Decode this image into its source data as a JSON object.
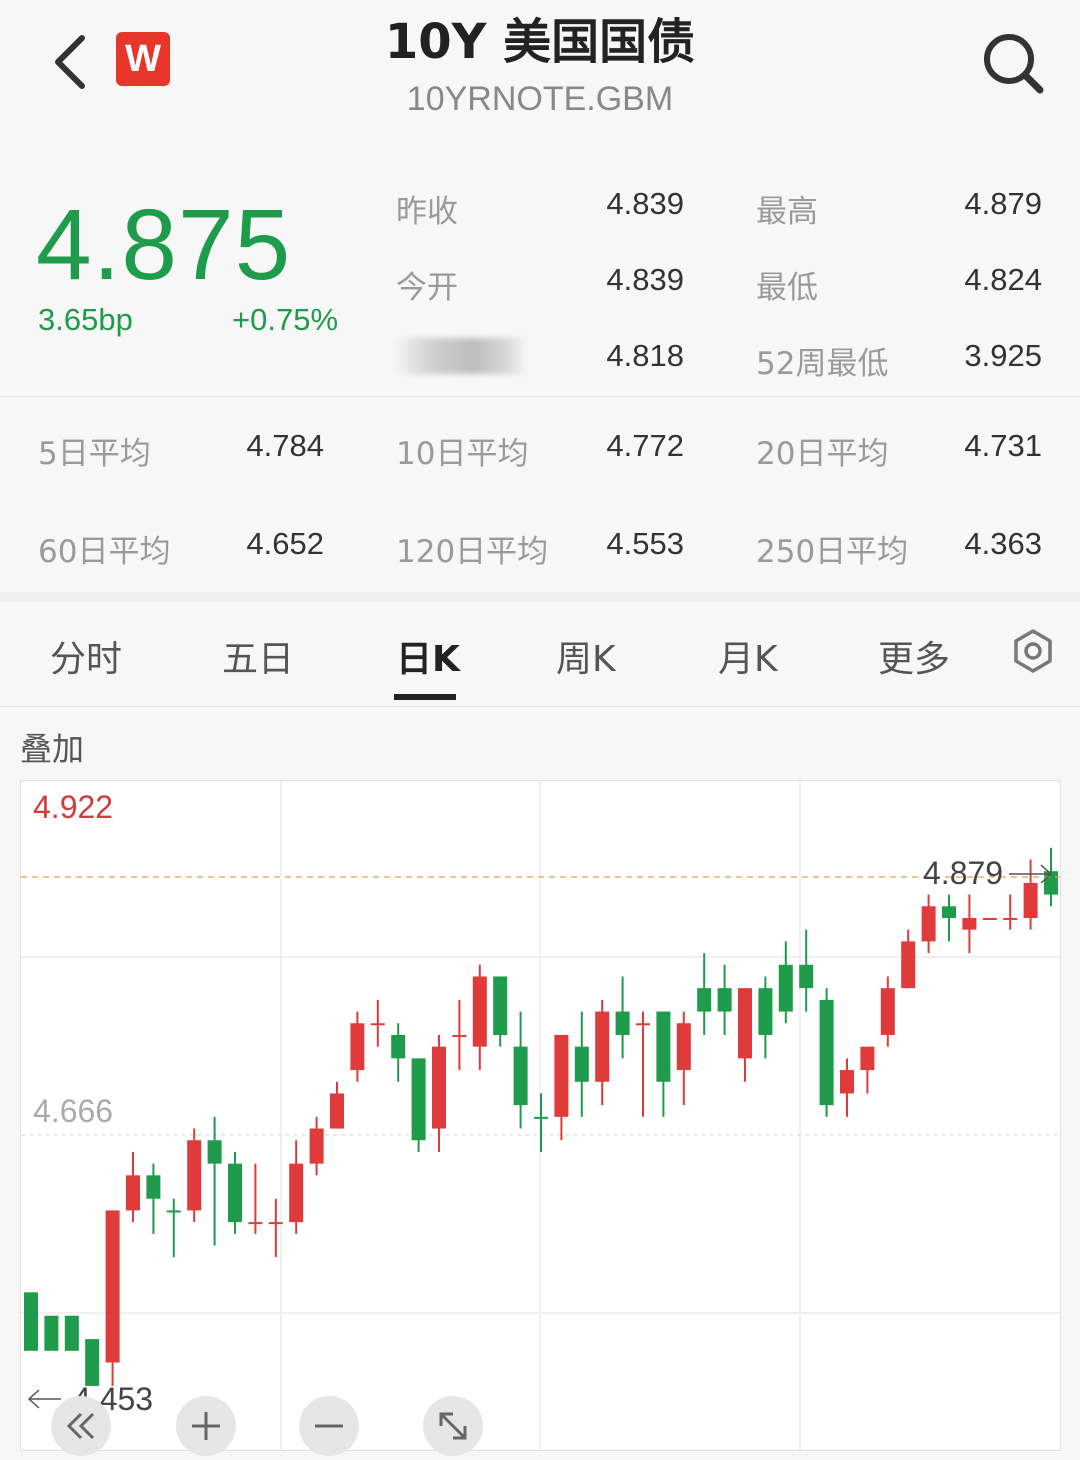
{
  "header": {
    "title": "10Y 美国国债",
    "subtitle": "10YRNOTE.GBM",
    "logo_text": "W",
    "back_icon": "chevron-left-icon",
    "search_icon": "search-icon"
  },
  "quote": {
    "price": "4.875",
    "change_bp": "3.65bp",
    "change_pct": "+0.75%",
    "color_up": "#e03b3b",
    "color_down": "#1e9b4b",
    "stats": [
      {
        "label": "昨收",
        "value": "4.839"
      },
      {
        "label": "最高",
        "value": "4.879"
      },
      {
        "label": "今开",
        "value": "4.839"
      },
      {
        "label": "最低",
        "value": "4.824"
      },
      {
        "label": "",
        "value": "4.818"
      },
      {
        "label": "52周最低",
        "value": "3.925"
      }
    ]
  },
  "averages": [
    {
      "label": "5日平均",
      "value": "4.784"
    },
    {
      "label": "10日平均",
      "value": "4.772"
    },
    {
      "label": "20日平均",
      "value": "4.731"
    },
    {
      "label": "60日平均",
      "value": "4.652"
    },
    {
      "label": "120日平均",
      "value": "4.553"
    },
    {
      "label": "250日平均",
      "value": "4.363"
    }
  ],
  "tabs": [
    {
      "label": "分时"
    },
    {
      "label": "五日"
    },
    {
      "label": "日K"
    },
    {
      "label": "周K"
    },
    {
      "label": "月K"
    },
    {
      "label": "更多"
    }
  ],
  "active_tab": "日K",
  "overlay_label": "叠加",
  "chart_data": {
    "type": "candlestick",
    "y_max_label": "4.922",
    "y_mid_label": "4.666",
    "high_marker": "4.879",
    "low_marker": "4.453",
    "ylim": [
      4.41,
      4.94
    ],
    "candles": [
      [
        4.52,
        4.47,
        4.49,
        4.48
      ],
      [
        4.5,
        4.47,
        4.49,
        4.48
      ],
      [
        4.5,
        4.47,
        4.49,
        4.48
      ],
      [
        4.48,
        4.44,
        4.45,
        4.44
      ],
      [
        4.46,
        4.59,
        4.59,
        4.44
      ],
      [
        4.59,
        4.62,
        4.64,
        4.58
      ],
      [
        4.62,
        4.6,
        4.63,
        4.57
      ],
      [
        4.59,
        4.59,
        4.6,
        4.55
      ],
      [
        4.59,
        4.65,
        4.66,
        4.58
      ],
      [
        4.65,
        4.63,
        4.67,
        4.56
      ],
      [
        4.63,
        4.58,
        4.64,
        4.57
      ],
      [
        4.58,
        4.58,
        4.63,
        4.57
      ],
      [
        4.58,
        4.58,
        4.6,
        4.55
      ],
      [
        4.58,
        4.63,
        4.65,
        4.57
      ],
      [
        4.63,
        4.66,
        4.67,
        4.62
      ],
      [
        4.66,
        4.69,
        4.7,
        4.66
      ],
      [
        4.71,
        4.75,
        4.76,
        4.7
      ],
      [
        4.75,
        4.75,
        4.77,
        4.73
      ],
      [
        4.74,
        4.72,
        4.75,
        4.7
      ],
      [
        4.72,
        4.65,
        4.71,
        4.64
      ],
      [
        4.66,
        4.73,
        4.74,
        4.64
      ],
      [
        4.74,
        4.74,
        4.77,
        4.71
      ],
      [
        4.73,
        4.79,
        4.8,
        4.71
      ],
      [
        4.79,
        4.74,
        4.79,
        4.73
      ],
      [
        4.73,
        4.68,
        4.76,
        4.66
      ],
      [
        4.67,
        4.67,
        4.69,
        4.64
      ],
      [
        4.67,
        4.74,
        4.74,
        4.65
      ],
      [
        4.73,
        4.7,
        4.76,
        4.67
      ],
      [
        4.7,
        4.76,
        4.77,
        4.68
      ],
      [
        4.76,
        4.74,
        4.79,
        4.72
      ],
      [
        4.75,
        4.75,
        4.76,
        4.67
      ],
      [
        4.76,
        4.7,
        4.76,
        4.67
      ],
      [
        4.71,
        4.75,
        4.76,
        4.68
      ],
      [
        4.78,
        4.76,
        4.81,
        4.74
      ],
      [
        4.78,
        4.76,
        4.8,
        4.74
      ],
      [
        4.72,
        4.78,
        4.78,
        4.7
      ],
      [
        4.78,
        4.74,
        4.79,
        4.72
      ],
      [
        4.8,
        4.76,
        4.82,
        4.75
      ],
      [
        4.8,
        4.78,
        4.83,
        4.76
      ],
      [
        4.77,
        4.68,
        4.78,
        4.67
      ],
      [
        4.69,
        4.71,
        4.72,
        4.67
      ],
      [
        4.71,
        4.73,
        4.73,
        4.69
      ],
      [
        4.74,
        4.78,
        4.79,
        4.73
      ],
      [
        4.78,
        4.82,
        4.83,
        4.78
      ],
      [
        4.82,
        4.85,
        4.86,
        4.81
      ],
      [
        4.85,
        4.84,
        4.86,
        4.82
      ],
      [
        4.83,
        4.84,
        4.86,
        4.81
      ],
      [
        4.84,
        4.84,
        4.84,
        4.84
      ],
      [
        4.84,
        4.84,
        4.86,
        4.83
      ],
      [
        4.84,
        4.87,
        4.89,
        4.83
      ],
      [
        4.88,
        4.86,
        4.9,
        4.85
      ]
    ]
  }
}
